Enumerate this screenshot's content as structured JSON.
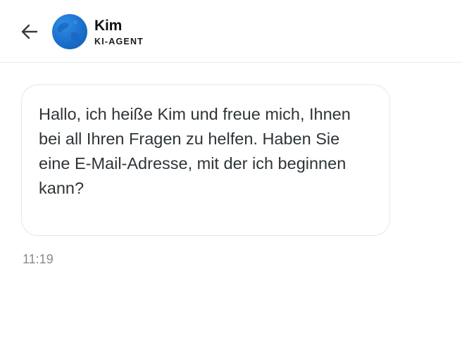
{
  "header": {
    "back_icon": "arrow-left-icon",
    "avatar_icon": "globe-avatar-icon",
    "agent_name": "Kim",
    "agent_role": "KI-AGENT"
  },
  "messages": [
    {
      "text": "Hallo, ich heiße Kim und freue mich, Ihnen bei all Ihren Fragen zu helfen. Haben Sie eine E-Mail-Adresse, mit der ich beginnen kann?",
      "time": "11:19"
    }
  ],
  "colors": {
    "avatar": "#1b6fcc",
    "text": "#2e3438",
    "timestamp": "#8a8a8a",
    "divider": "#ebebeb"
  }
}
